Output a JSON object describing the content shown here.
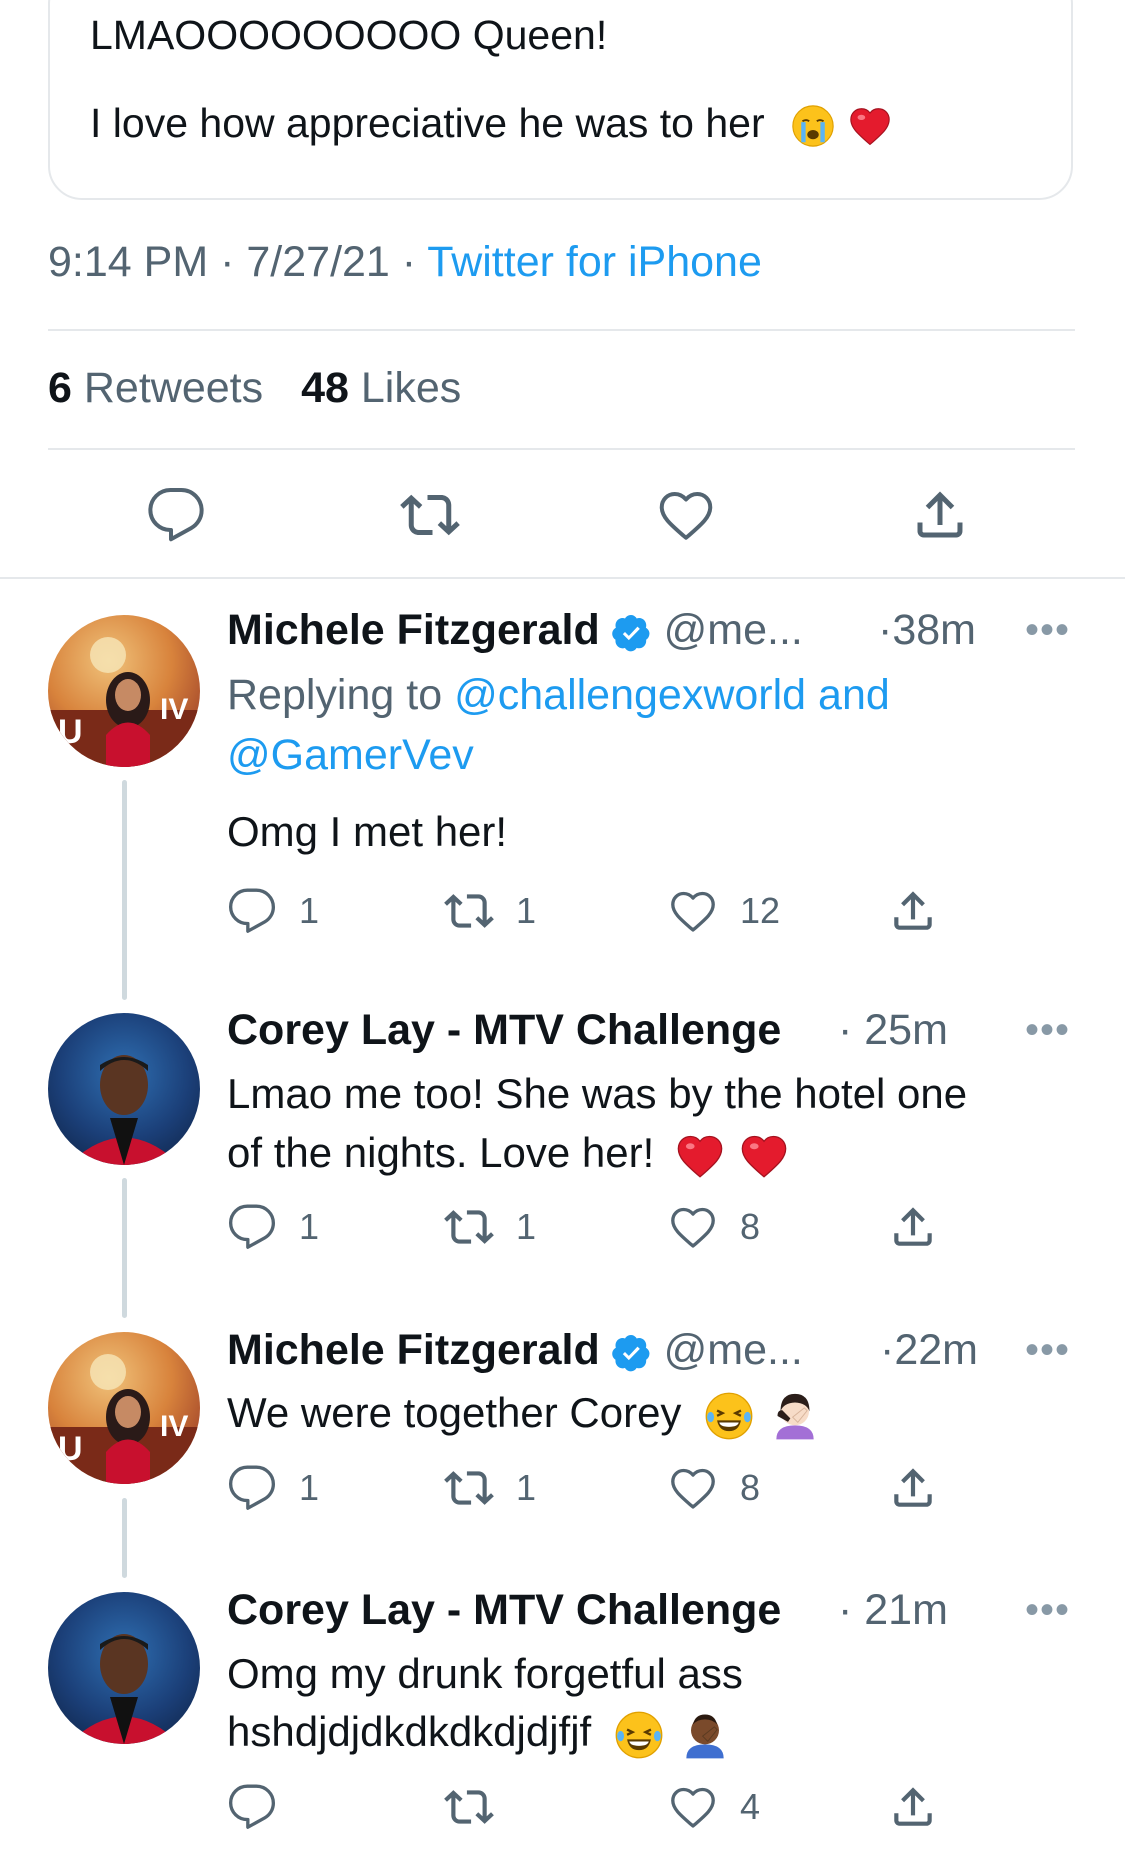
{
  "quoted": {
    "line1": "LMAOOOOOOOOO Queen!",
    "line2": "I love how appreciative he was to her"
  },
  "meta": {
    "time": "9:14 PM",
    "date": "7/27/21",
    "source": "Twitter for iPhone",
    "sep": "·"
  },
  "stats": {
    "retweets_count": "6",
    "retweets_label": "Retweets",
    "likes_count": "48",
    "likes_label": "Likes"
  },
  "replies": [
    {
      "name": "Michele Fitzgerald",
      "handle": "@me...",
      "time": "·38m",
      "replying_prefix": "Replying to",
      "replying_to_1": "@challengexworld and",
      "replying_to_2": "@GamerVev",
      "text": "Omg I met her!",
      "replies": "1",
      "retweets": "1",
      "likes": "12"
    },
    {
      "name": "Corey Lay - MTV Challenge",
      "time": "· 25m",
      "line1": "Lmao me too! She was by the hotel one",
      "line2": "of the nights. Love her!",
      "replies": "1",
      "retweets": "1",
      "likes": "8"
    },
    {
      "name": "Michele Fitzgerald",
      "handle": "@me...",
      "time": "·22m",
      "text": "We were together Corey",
      "replies": "1",
      "retweets": "1",
      "likes": "8"
    },
    {
      "name": "Corey Lay - MTV Challenge",
      "time": "· 21m",
      "line1": "Omg my drunk forgetful ass",
      "line2": "hshdjdjdkdkdkdjdjfjf",
      "replies": "",
      "retweets": "",
      "likes": "4"
    }
  ],
  "more_label": "•••",
  "icons": [
    "reply-icon",
    "retweet-icon",
    "like-icon",
    "share-icon",
    "verified-icon"
  ],
  "colors": {
    "accent": "#1d9bf0",
    "muted": "#536471",
    "heart": "#e0245e"
  }
}
